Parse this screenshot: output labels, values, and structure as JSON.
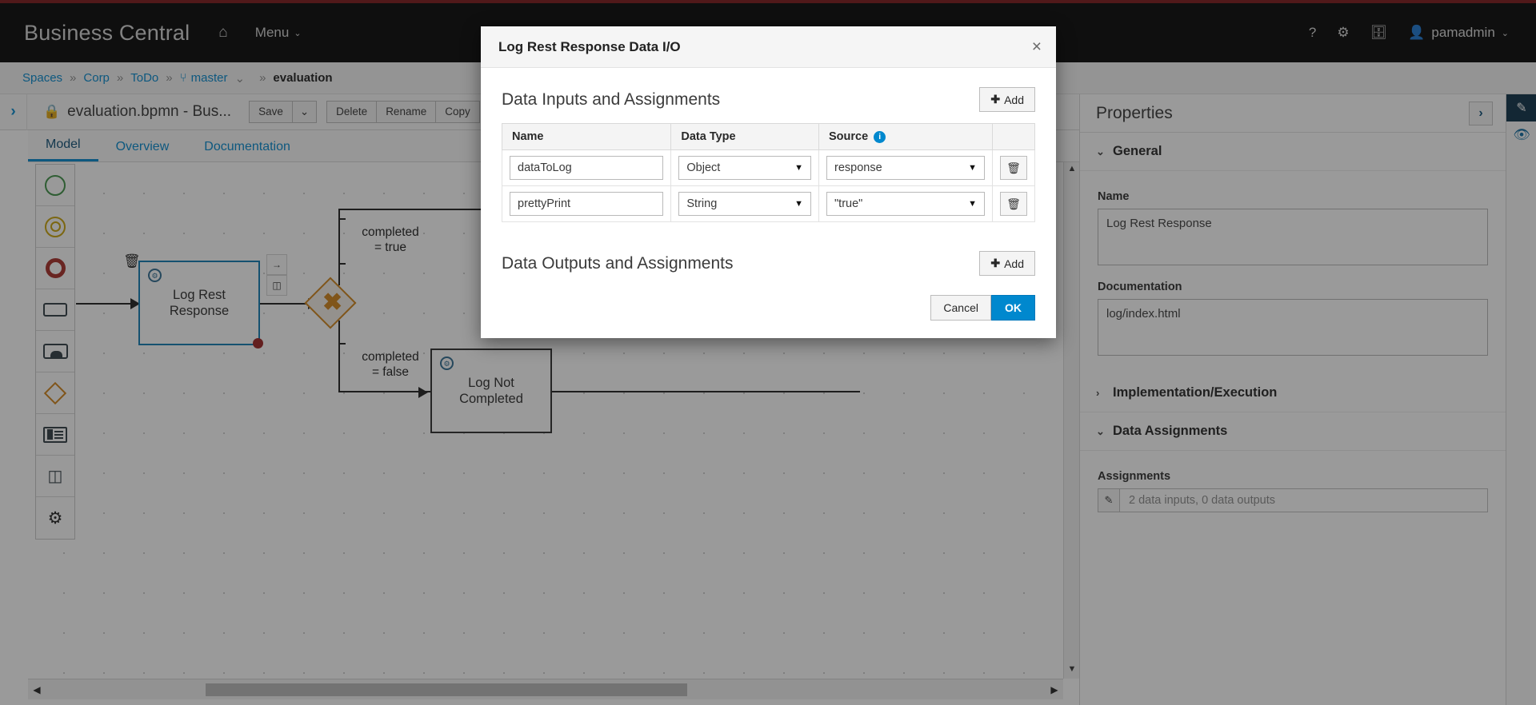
{
  "masthead": {
    "brand": "Business Central",
    "home_icon": "home-icon",
    "menu_label": "Menu",
    "menu_caret": "⌄",
    "help_icon": "?",
    "settings_icon": "gear-icon",
    "toolbox_icon": "toolbox-icon",
    "user_icon": "user-icon",
    "user_name": "pamadmin",
    "user_caret": "⌄"
  },
  "breadcrumb": {
    "separator": "»",
    "items": [
      "Spaces",
      "Corp",
      "ToDo",
      "master",
      "evaluation"
    ],
    "branch_icon": "branch-icon",
    "branch_caret": "⌄"
  },
  "editor": {
    "expand_icon": "›",
    "lock_icon": "lock-icon",
    "file_title": "evaluation.bpmn - Bus...",
    "buttons": {
      "save": "Save",
      "save_caret": "⌄",
      "delete": "Delete",
      "rename": "Rename",
      "copy": "Copy",
      "hidden": "↳"
    },
    "tabs": [
      {
        "label": "Model",
        "active": true
      },
      {
        "label": "Overview",
        "active": false
      },
      {
        "label": "Documentation",
        "active": false
      }
    ]
  },
  "palette": {
    "items": [
      {
        "name": "start-event-tool",
        "icon": "start-event-icon"
      },
      {
        "name": "intermediate-event-tool",
        "icon": "intermediate-event-icon"
      },
      {
        "name": "end-event-tool",
        "icon": "end-event-icon"
      },
      {
        "name": "task-tool",
        "icon": "task-icon"
      },
      {
        "name": "subprocess-tool",
        "icon": "subprocess-icon"
      },
      {
        "name": "gateway-tool",
        "icon": "gateway-icon"
      },
      {
        "name": "data-object-tool",
        "icon": "data-object-icon"
      },
      {
        "name": "swimlane-tool",
        "icon": "swimlane-icon"
      },
      {
        "name": "custom-tasks-tool",
        "icon": "gears-icon"
      }
    ]
  },
  "canvas": {
    "selected_task": "Log Rest Response",
    "selected_task_line1": "Log Rest",
    "selected_task_line2": "Response",
    "gateway_symbol": "✖",
    "condition_true_line1": "completed",
    "condition_true_line2": "= true",
    "condition_false_line1": "completed",
    "condition_false_line2": "= false",
    "task2_line1": "Log Not",
    "task2_line2": "Completed",
    "trash_icon": "trash-icon",
    "seq_flow_icon": "sequence-flow-icon",
    "lane_icon": "swimlane-icon",
    "service_task_icon": "service-task-icon"
  },
  "scrollbars": {
    "left_arrow": "◀",
    "right_arrow": "▶",
    "up_arrow": "▲",
    "down_arrow": "▼"
  },
  "properties": {
    "title": "Properties",
    "collapse_icon": "›",
    "sections": [
      {
        "label": "General",
        "expanded": true,
        "twisty": "⌄"
      },
      {
        "label": "Implementation/Execution",
        "expanded": false,
        "twisty": "›"
      },
      {
        "label": "Data Assignments",
        "expanded": true,
        "twisty": "⌄"
      }
    ],
    "name_label": "Name",
    "name_value": "Log Rest Response",
    "documentation_label": "Documentation",
    "documentation_value": "log/index.html",
    "assignments_label": "Assignments",
    "assignments_value": "2 data inputs, 0 data outputs",
    "assignments_edit_icon": "edit-icon"
  },
  "rail": {
    "edit_icon": "edit-icon",
    "preview_icon": "eye-icon"
  },
  "modal": {
    "title": "Log Rest Response Data I/O",
    "close_icon": "×",
    "inputs_section_title": "Data Inputs and Assignments",
    "outputs_section_title": "Data Outputs and Assignments",
    "add_label": "Add",
    "add_plus": "✚",
    "columns": [
      "Name",
      "Data Type",
      "Source"
    ],
    "source_info_icon": "info-icon",
    "source_info_glyph": "i",
    "delete_icon": "trash-icon",
    "dropdown_caret": "▼",
    "rows": [
      {
        "name": "dataToLog",
        "data_type": "Object",
        "source": "response"
      },
      {
        "name": "prettyPrint",
        "data_type": "String",
        "source": "\"true\""
      }
    ],
    "cancel_label": "Cancel",
    "ok_label": "OK"
  },
  "colors": {
    "brand_bar": "#7b1416",
    "masthead": "#030303",
    "link": "#0088ce",
    "primary_button": "#0088ce",
    "selection": "#0d7bb3",
    "gateway": "#d08216",
    "start_event": "#3c9144",
    "end_event": "#a62b25"
  }
}
